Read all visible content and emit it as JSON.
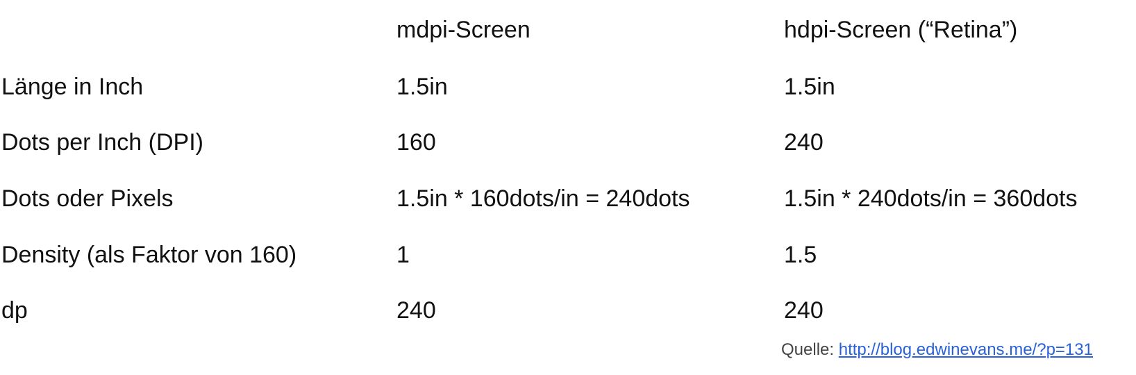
{
  "table": {
    "header": [
      "",
      "mdpi-Screen",
      "hdpi-Screen (“Retina”)"
    ],
    "rows": [
      [
        "Länge in Inch",
        "1.5in",
        "1.5in"
      ],
      [
        "Dots per Inch (DPI)",
        "160",
        "240"
      ],
      [
        "Dots oder Pixels",
        "1.5in * 160dots/in = 240dots",
        "1.5in * 240dots/in = 360dots"
      ],
      [
        "Density (als Faktor von 160)",
        "1",
        "1.5"
      ],
      [
        "dp",
        "240",
        "240"
      ]
    ]
  },
  "source": {
    "label": "Quelle: ",
    "link_text": "http://blog.edwinevans.me/?p=131",
    "link_color": "#2962d8"
  }
}
